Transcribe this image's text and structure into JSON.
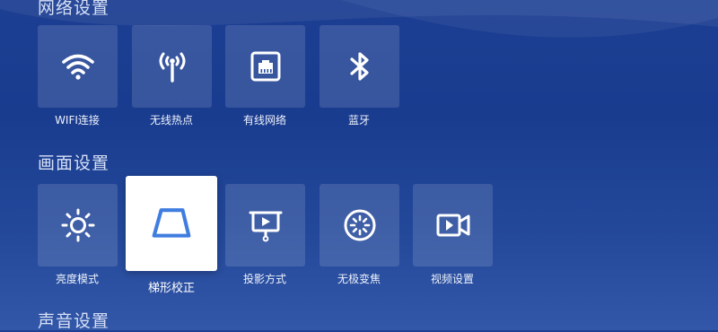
{
  "sections": {
    "network": {
      "title": "网络设置",
      "items": [
        {
          "label": "WIFI连接",
          "icon": "wifi-icon"
        },
        {
          "label": "无线热点",
          "icon": "hotspot-icon"
        },
        {
          "label": "有线网络",
          "icon": "ethernet-icon"
        },
        {
          "label": "蓝牙",
          "icon": "bluetooth-icon"
        }
      ]
    },
    "picture": {
      "title": "画面设置",
      "items": [
        {
          "label": "亮度模式",
          "icon": "brightness-icon"
        },
        {
          "label": "梯形校正",
          "icon": "keystone-icon",
          "selected": true
        },
        {
          "label": "投影方式",
          "icon": "projection-icon"
        },
        {
          "label": "无极变焦",
          "icon": "focus-icon"
        },
        {
          "label": "视频设置",
          "icon": "video-icon"
        }
      ]
    },
    "sound": {
      "title": "声音设置"
    }
  },
  "colors": {
    "background_top": "#1d3f93",
    "background_bottom": "#3357a8",
    "tile": "rgba(255,255,255,0.13)",
    "selected_tile": "#ffffff",
    "accent": "#3f7de0"
  }
}
